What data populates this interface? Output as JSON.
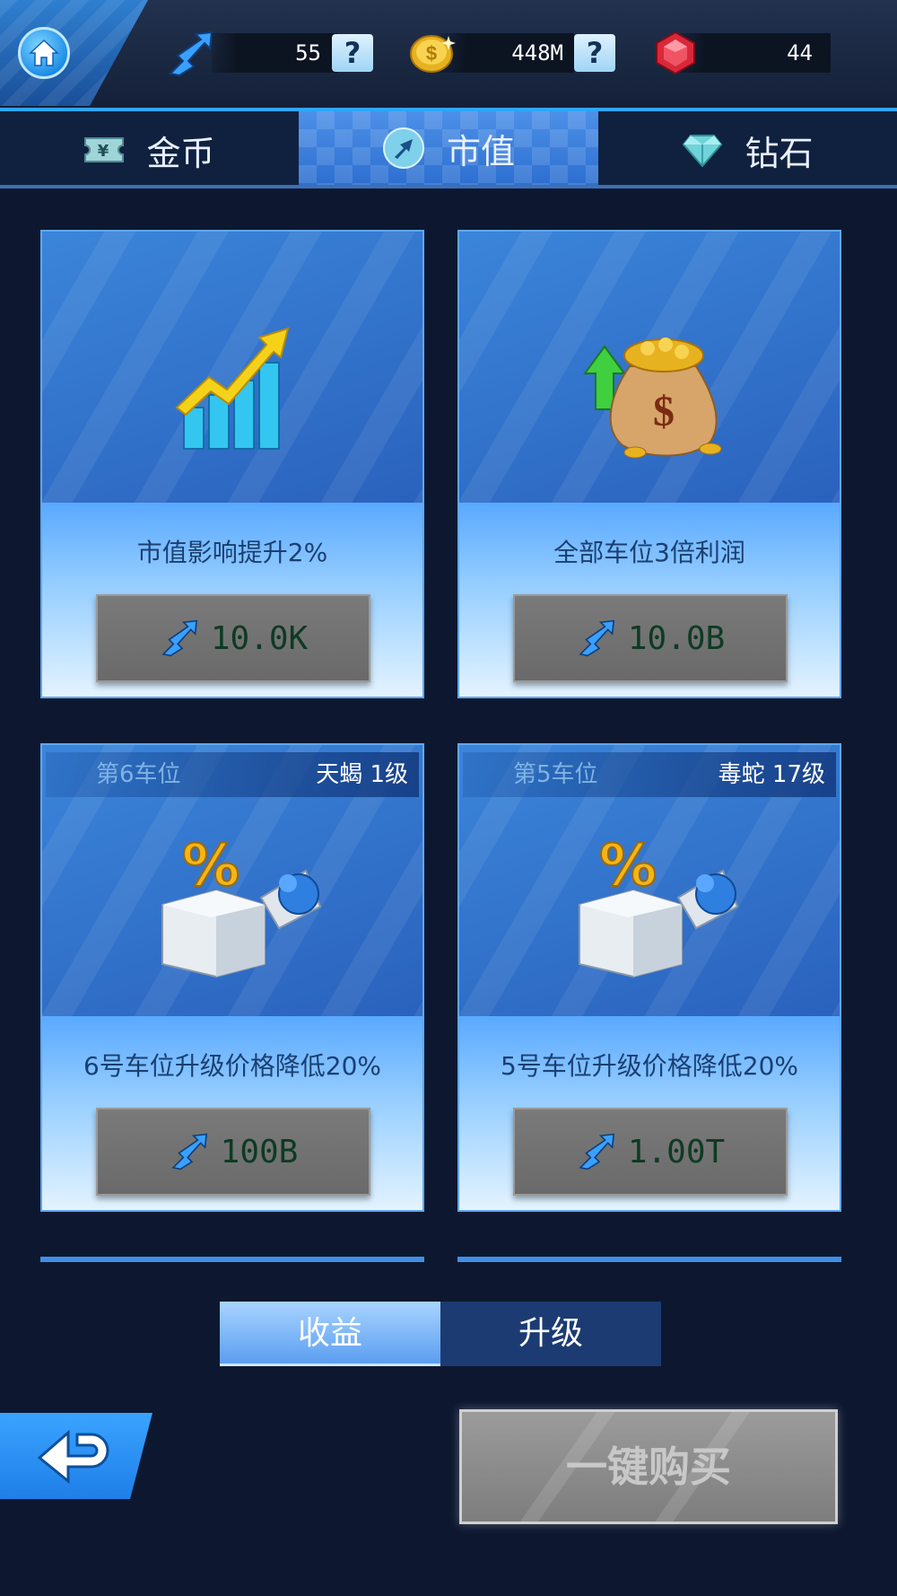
{
  "resources": {
    "market_value": "55",
    "coins": "448M",
    "gems": "44",
    "help_symbol": "?"
  },
  "tabs": [
    {
      "label": "金币",
      "icon": "ticket-icon"
    },
    {
      "label": "市值",
      "icon": "market-value-icon",
      "active": true
    },
    {
      "label": "钻石",
      "icon": "diamond-icon"
    }
  ],
  "cards": [
    {
      "desc": "市值影响提升2%",
      "price": "10.0K",
      "icon": "growth-chart-icon"
    },
    {
      "desc": "全部车位3倍利润",
      "price": "10.0B",
      "icon": "money-bag-icon"
    },
    {
      "slot": "第6车位",
      "car": "天蝎  1级",
      "desc": "6号车位升级价格降低20%",
      "price": "100B",
      "icon": "discount-gift-icon"
    },
    {
      "slot": "第5车位",
      "car": "毒蛇  17级",
      "desc": "5号车位升级价格降低20%",
      "price": "1.00T",
      "icon": "discount-gift-icon"
    }
  ],
  "toggle": {
    "income": "收益",
    "upgrade": "升级"
  },
  "buy_all_label": "一键购买",
  "colors": {
    "accent": "#2fa6ff",
    "background": "#0d1830",
    "card_blue": "#2d73cc",
    "price_text": "#0e3a24"
  }
}
